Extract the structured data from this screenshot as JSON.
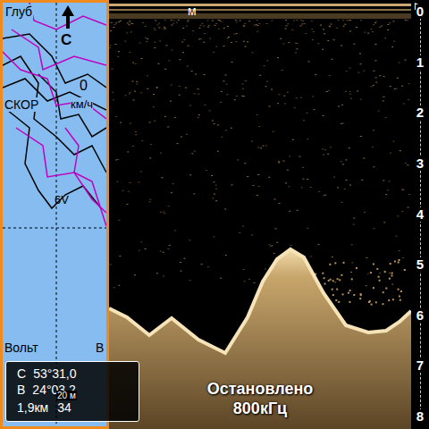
{
  "map": {
    "depth_label": "Глуб",
    "north": "С",
    "speed_label": "СКОР",
    "speed_value": "0",
    "speed_unit": "км/ч",
    "waypoint": "6V",
    "volt_label": "Вольт",
    "volt_unit": "В"
  },
  "info_box": {
    "lat_prefix": "С",
    "lat": "53°31,0",
    "lon_prefix": "В",
    "lon": "24°03,2",
    "distance": "1,9км",
    "bearing": "34",
    "scale": "20 м"
  },
  "sonar": {
    "unit": "м",
    "arrow": "▶",
    "depth_ticks": [
      "0",
      "1",
      "2",
      "3",
      "4",
      "5",
      "6",
      "7",
      "8"
    ],
    "status": "Остановлено",
    "frequency": "800кГц"
  }
}
